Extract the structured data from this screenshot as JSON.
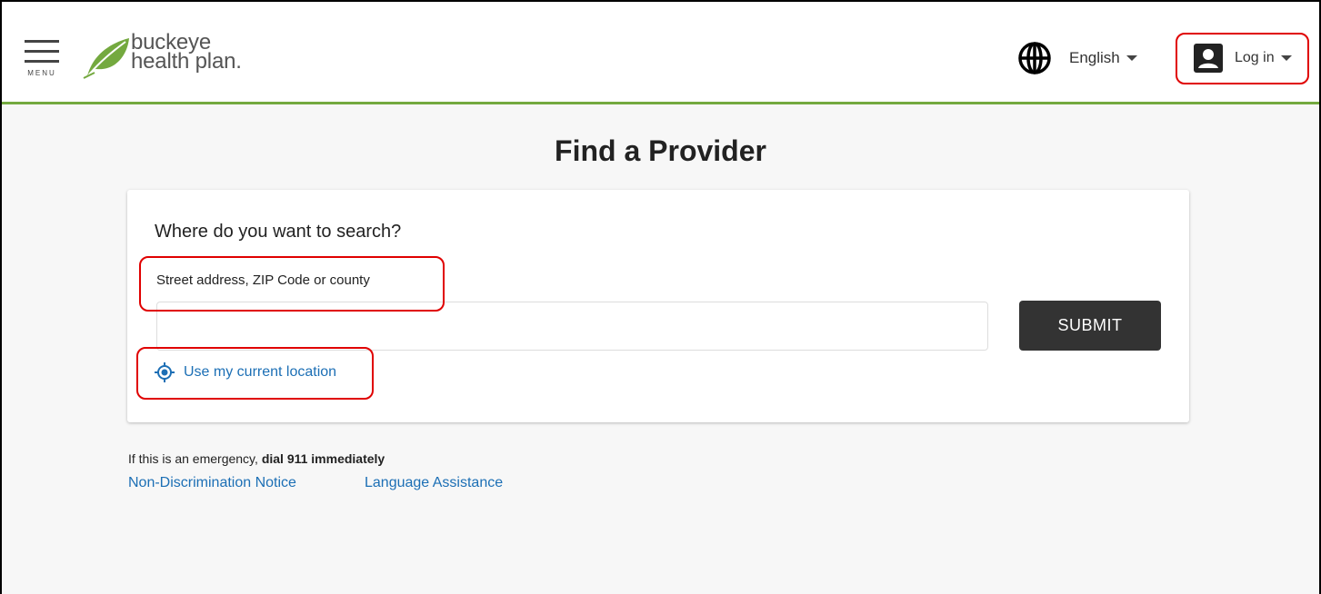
{
  "header": {
    "menu_label": "MENU",
    "logo_line1": "buckeye",
    "logo_line2": "health plan.",
    "language_label": "English",
    "login_label": "Log in"
  },
  "main": {
    "title": "Find a Provider",
    "card": {
      "question": "Where do you want to search?",
      "field_label": "Street address, ZIP Code or county",
      "input_value": "",
      "submit_label": "SUBMIT",
      "location_link": "Use my current location"
    },
    "emergency_prefix": "If this is an emergency, ",
    "emergency_bold": "dial 911 immediately",
    "footer_links": [
      "Non-Discrimination Notice",
      "Language Assistance"
    ]
  },
  "colors": {
    "brand_green": "#74a93f",
    "link_blue": "#1c6fb5",
    "button_dark": "#333333",
    "highlight_red": "#e00000"
  },
  "icons": [
    "menu-icon",
    "leaf-logo-icon",
    "globe-icon",
    "user-icon",
    "location-target-icon",
    "chevron-down-icon"
  ]
}
